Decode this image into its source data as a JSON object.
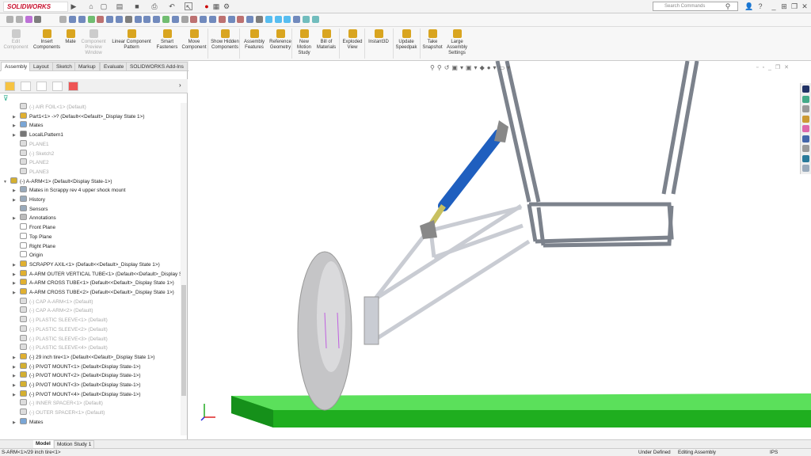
{
  "app": {
    "logo": "SOLIDWORKS",
    "search_placeholder": "Search Commands"
  },
  "ribbon": [
    {
      "label": "Edit Component",
      "disabled": true
    },
    {
      "label": "Insert Components",
      "disabled": false
    },
    {
      "label": "Mate",
      "disabled": false
    },
    {
      "label": "Component Preview Window",
      "disabled": true
    },
    {
      "label": "Linear Component Pattern",
      "disabled": false
    },
    {
      "label": "Smart Fasteners",
      "disabled": false
    },
    {
      "label": "Move Component",
      "disabled": false
    },
    {
      "label": "Show Hidden Components",
      "disabled": false
    },
    {
      "label": "Assembly Features",
      "disabled": false
    },
    {
      "label": "Reference Geometry",
      "disabled": false
    },
    {
      "label": "New Motion Study",
      "disabled": false
    },
    {
      "label": "Bill of Materials",
      "disabled": false
    },
    {
      "label": "Exploded View",
      "disabled": false
    },
    {
      "label": "Instant3D",
      "disabled": false
    },
    {
      "label": "Update Speedpak",
      "disabled": false
    },
    {
      "label": "Take Snapshot",
      "disabled": false
    },
    {
      "label": "Large Assembly Settings",
      "disabled": false
    }
  ],
  "tabs": [
    "Assembly",
    "Layout",
    "Sketch",
    "Markup",
    "Evaluate",
    "SOLIDWORKS Add-Ins"
  ],
  "tree": [
    {
      "label": "(-) AIR FOIL<1> (Default)",
      "lvl": 1,
      "grey": true,
      "icon": "part",
      "exp": false
    },
    {
      "label": "Part1<1> ->? (Default<<Default>_Display State 1>)",
      "lvl": 1,
      "grey": false,
      "icon": "part",
      "exp": true
    },
    {
      "label": "Mates",
      "lvl": 1,
      "grey": false,
      "icon": "mates",
      "exp": true
    },
    {
      "label": "LocalLPattern1",
      "lvl": 1,
      "grey": false,
      "icon": "pattern",
      "exp": true
    },
    {
      "label": "PLANE1",
      "lvl": 1,
      "grey": true,
      "icon": "plane",
      "exp": false
    },
    {
      "label": "(-) Sketch2",
      "lvl": 1,
      "grey": true,
      "icon": "sketch",
      "exp": false
    },
    {
      "label": "PLANE2",
      "lvl": 1,
      "grey": true,
      "icon": "plane",
      "exp": false
    },
    {
      "label": "PLANE3",
      "lvl": 1,
      "grey": true,
      "icon": "plane",
      "exp": false
    },
    {
      "label": "(-) A-ARM<1> (Default<Display State-1>)",
      "lvl": 0,
      "grey": false,
      "icon": "assembly",
      "exp": "open"
    },
    {
      "label": "Mates in Scrappy rev 4 upper shock mount",
      "lvl": 1,
      "grey": false,
      "icon": "folder",
      "exp": true
    },
    {
      "label": "History",
      "lvl": 1,
      "grey": false,
      "icon": "folder",
      "exp": true
    },
    {
      "label": "Sensors",
      "lvl": 1,
      "grey": false,
      "icon": "folder",
      "exp": false
    },
    {
      "label": "Annotations",
      "lvl": 1,
      "grey": false,
      "icon": "annot",
      "exp": true
    },
    {
      "label": "Front Plane",
      "lvl": 1,
      "grey": false,
      "icon": "refplane",
      "exp": false
    },
    {
      "label": "Top Plane",
      "lvl": 1,
      "grey": false,
      "icon": "refplane",
      "exp": false
    },
    {
      "label": "Right Plane",
      "lvl": 1,
      "grey": false,
      "icon": "refplane",
      "exp": false
    },
    {
      "label": "Origin",
      "lvl": 1,
      "grey": false,
      "icon": "origin",
      "exp": false
    },
    {
      "label": "SCRAPPY AXIL<1> (Default<<Default>_Display State 1>)",
      "lvl": 1,
      "grey": false,
      "icon": "part",
      "exp": true
    },
    {
      "label": "A-ARM OUTER VERTICAL TUBE<1> (Default<<Default>_Display St",
      "lvl": 1,
      "grey": false,
      "icon": "part",
      "exp": true
    },
    {
      "label": "A-ARM CROSS TUBE<1> (Default<<Default>_Display State 1>)",
      "lvl": 1,
      "grey": false,
      "icon": "part",
      "exp": true
    },
    {
      "label": "A-ARM CROSS TUBE<2> (Default<<Default>_Display State 1>)",
      "lvl": 1,
      "grey": false,
      "icon": "part",
      "exp": true
    },
    {
      "label": "(-) CAP A-ARM<1> (Default)",
      "lvl": 1,
      "grey": true,
      "icon": "part",
      "exp": false
    },
    {
      "label": "(-) CAP A-ARM<2> (Default)",
      "lvl": 1,
      "grey": true,
      "icon": "part",
      "exp": false
    },
    {
      "label": "(-) PLASTIC SLEEVE<1> (Default)",
      "lvl": 1,
      "grey": true,
      "icon": "part",
      "exp": false
    },
    {
      "label": "(-) PLASTIC SLEEVE<2> (Default)",
      "lvl": 1,
      "grey": true,
      "icon": "part",
      "exp": false
    },
    {
      "label": "(-) PLASTIC SLEEVE<3> (Default)",
      "lvl": 1,
      "grey": true,
      "icon": "part",
      "exp": false
    },
    {
      "label": "(-) PLASTIC SLEEVE<4> (Default)",
      "lvl": 1,
      "grey": true,
      "icon": "part",
      "exp": false
    },
    {
      "label": "(-) 29 inch tire<1> (Default<<Default>_Display State 1>)",
      "lvl": 1,
      "grey": false,
      "icon": "part",
      "exp": true
    },
    {
      "label": "(-) PIVOT MOUNT<1> (Default<Display State-1>)",
      "lvl": 1,
      "grey": false,
      "icon": "assembly",
      "exp": true
    },
    {
      "label": "(-) PIVOT MOUNT<2> (Default<Display State-1>)",
      "lvl": 1,
      "grey": false,
      "icon": "assembly",
      "exp": true
    },
    {
      "label": "(-) PIVOT MOUNT<3> (Default<Display State-1>)",
      "lvl": 1,
      "grey": false,
      "icon": "assembly",
      "exp": true
    },
    {
      "label": "(-) PIVOT MOUNT<4> (Default<Display State-1>)",
      "lvl": 1,
      "grey": false,
      "icon": "assembly",
      "exp": true
    },
    {
      "label": "(-) INNER SPACER<1> (Default)",
      "lvl": 1,
      "grey": true,
      "icon": "part",
      "exp": false
    },
    {
      "label": "(-) OUTER SPACER<1> (Default)",
      "lvl": 1,
      "grey": true,
      "icon": "part",
      "exp": false
    },
    {
      "label": "Mates",
      "lvl": 1,
      "grey": false,
      "icon": "mates",
      "exp": true
    }
  ],
  "bottom_tabs": [
    "Model",
    "Motion Study 1"
  ],
  "status": {
    "path": "S-ARM<1>/29 inch tire<1>",
    "defined": "Under Defined",
    "mode": "Editing Assembly",
    "units": "IPS"
  },
  "colors": {
    "ground": "#2ecc2e",
    "tire": "#b8b8b8",
    "shock": "#1f5fbf",
    "frame": "#9a9fa8"
  }
}
